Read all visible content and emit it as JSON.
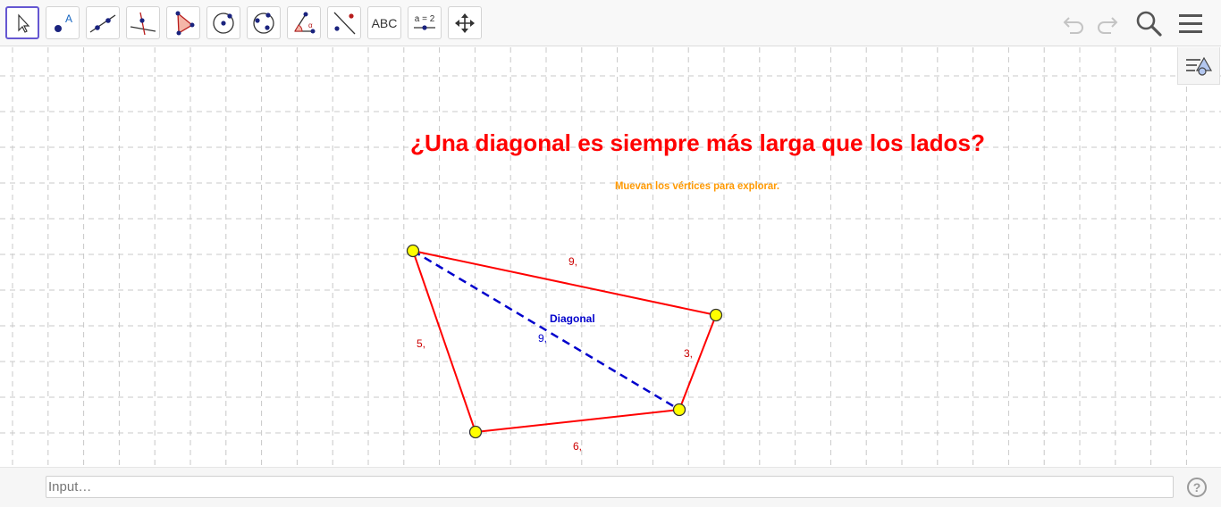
{
  "toolbar": {
    "tools": [
      {
        "name": "move-tool",
        "label": ""
      },
      {
        "name": "point-tool",
        "label": ""
      },
      {
        "name": "line-tool",
        "label": ""
      },
      {
        "name": "perpendicular-line-tool",
        "label": ""
      },
      {
        "name": "polygon-tool",
        "label": ""
      },
      {
        "name": "circle-center-point-tool",
        "label": ""
      },
      {
        "name": "circle-three-points-tool",
        "label": ""
      },
      {
        "name": "angle-tool",
        "label": ""
      },
      {
        "name": "reflect-tool",
        "label": ""
      },
      {
        "name": "text-tool",
        "label": "ABC"
      },
      {
        "name": "slider-tool",
        "label": "a = 2"
      },
      {
        "name": "move-graphics-view-tool",
        "label": ""
      }
    ],
    "right_icons": [
      "undo-icon",
      "redo-icon",
      "search-icon",
      "menu-icon"
    ]
  },
  "graphics": {
    "title": "¿Una diagonal es siempre más larga que los lados?",
    "title_color": "#ff0000",
    "subtitle": "Muevan los vértices para explorar.",
    "subtitle_color": "#ff9900",
    "diagonal_label": "Diagonal",
    "diagonal_color": "#0000cc",
    "side_color": "#ff0000",
    "vertex_fill": "#ffff00",
    "side_labels": {
      "top": "9,",
      "right": "3,",
      "bottom": "6,",
      "left": "5,"
    },
    "diagonal_length_label": "9,"
  },
  "style_bar_toggle": "style-bar-icon",
  "input_bar": {
    "placeholder": "Input…",
    "value": "",
    "help_icon": "?"
  }
}
